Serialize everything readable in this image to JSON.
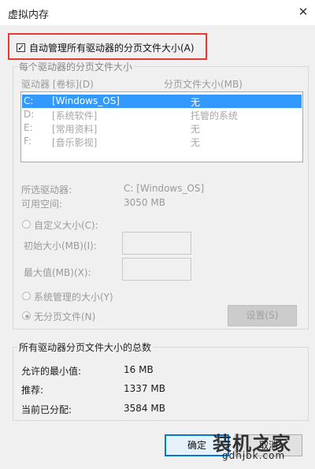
{
  "window": {
    "title": "虚拟内存",
    "close_glyph": "✕"
  },
  "auto_manage": {
    "label": "自动管理所有驱动器的分页文件大小(A)",
    "checked": true,
    "check_glyph": "✓",
    "highlight_color": "#e53935"
  },
  "drives_group": {
    "title": "每个驱动器的分页文件大小",
    "col_drive": "驱动器 [卷标](D)",
    "col_size": "分页文件大小(MB)",
    "rows": [
      {
        "drive": "C:",
        "label": "[Windows_OS]",
        "size": "无",
        "selected": true
      },
      {
        "drive": "D:",
        "label": "[系统软件]",
        "size": "托管的系统",
        "selected": false
      },
      {
        "drive": "E:",
        "label": "[常用资料]",
        "size": "无",
        "selected": false
      },
      {
        "drive": "F:",
        "label": "[音乐影视]",
        "size": "无",
        "selected": false
      }
    ],
    "selected_drive_label": "所选驱动器:",
    "selected_drive_value": "C:  [Windows_OS]",
    "free_space_label": "可用空间:",
    "free_space_value": "3050 MB",
    "custom_size_label": "自定义大小(C):",
    "initial_size_label": "初始大小(MB)(I):",
    "initial_size_value": "",
    "max_size_label": "最大值(MB)(X):",
    "max_size_value": "",
    "system_managed_label": "系统管理的大小(Y)",
    "no_paging_label": "无分页文件(N)",
    "set_button": "设置(S)",
    "selection_color": "#3399ff"
  },
  "totals_group": {
    "title": "所有驱动器分页文件大小的总数",
    "min_label": "允许的最小值:",
    "min_value": "16 MB",
    "recommended_label": "推荐:",
    "recommended_value": "1337 MB",
    "current_label": "当前已分配:",
    "current_value": "3584 MB"
  },
  "buttons": {
    "ok": "确定",
    "cancel": "取消"
  },
  "watermark": {
    "text": "装机之家",
    "sub": "gdhjbk.com"
  }
}
